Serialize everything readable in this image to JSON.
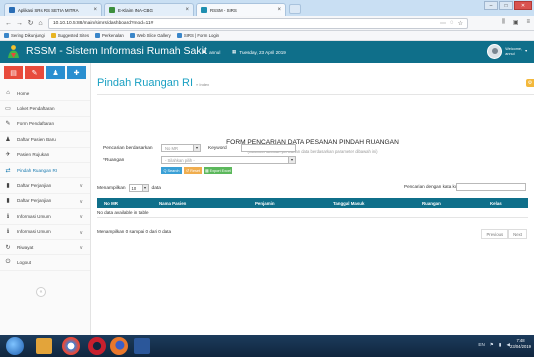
{
  "browser": {
    "tabs": [
      {
        "label": "Aplikasi SRs RS SETIA MITRA",
        "color": "#2a6db5",
        "active": false
      },
      {
        "label": "E-Klaim INA-CBG",
        "color": "#3d8f3d",
        "active": false
      },
      {
        "label": "RSSM - SIRS",
        "color": "#1f8fb0",
        "active": true
      }
    ],
    "window_controls": {
      "minimize": "–",
      "maximize": "□",
      "close": "✕"
    },
    "url": "10.10.10.5:88/main/simrs/dashboard?mod=11#",
    "bookmarks": [
      {
        "label": "Sering Dikunjungi",
        "color": "#3a86c9"
      },
      {
        "label": "Suggested Sites",
        "color": "#e7b423"
      },
      {
        "label": "Perkenalan",
        "color": "#3a86c9"
      },
      {
        "label": "Web Slice Gallery",
        "color": "#3a86c9"
      },
      {
        "label": "SIRS | Form Login",
        "color": "#3a86c9"
      }
    ]
  },
  "app": {
    "title": "RSSM - Sistem Informasi Rumah Sakit",
    "user": "annul",
    "date": "Tuesday, 23 April 2019",
    "welcome": "Welcome,",
    "welcome_user": "annul"
  },
  "sidebar": {
    "quick_buttons": [
      {
        "icon": "chart-icon",
        "glyph": "▤",
        "color": "#e84b3c"
      },
      {
        "icon": "pencil-icon",
        "glyph": "✎",
        "color": "#e84b3c"
      },
      {
        "icon": "user-icon",
        "glyph": "♟",
        "color": "#2a8fd0"
      },
      {
        "icon": "settings-icon",
        "glyph": "✚",
        "color": "#2a8fd0"
      }
    ],
    "items": [
      {
        "label": "Home",
        "icon": "home-icon",
        "glyph": "⌂",
        "chev": ""
      },
      {
        "label": "Loket Pendaftaran",
        "icon": "desk-icon",
        "glyph": "▭",
        "chev": ""
      },
      {
        "label": "Form Pendaftaran",
        "icon": "form-icon",
        "glyph": "✎",
        "chev": ""
      },
      {
        "label": "Daftar Pasien Baru",
        "icon": "patient-icon",
        "glyph": "♟",
        "chev": ""
      },
      {
        "label": "Pasien Rujukan",
        "icon": "referral-icon",
        "glyph": "✈",
        "chev": ""
      },
      {
        "label": "Pindah Ruangan RI",
        "icon": "transfer-icon",
        "glyph": "⇄",
        "chev": "",
        "active": true
      },
      {
        "label": "Daftar Perjanjian",
        "icon": "lock-icon",
        "glyph": "▮",
        "chev": "∨"
      },
      {
        "label": "Daftar Perjanjian",
        "icon": "lock-icon",
        "glyph": "▮",
        "chev": "∨"
      },
      {
        "label": "Informasi Umum",
        "icon": "info-icon",
        "glyph": "ℹ",
        "chev": "∨"
      },
      {
        "label": "Informasi Umum",
        "icon": "info-icon",
        "glyph": "ℹ",
        "chev": "∨"
      },
      {
        "label": "Riwayat",
        "icon": "history-icon",
        "glyph": "↻",
        "chev": "∨"
      },
      {
        "label": "Logout",
        "icon": "power-icon",
        "glyph": "⏻",
        "chev": ""
      }
    ],
    "collapse_glyph": "«"
  },
  "main": {
    "page_title": "Pindah Ruangan RI",
    "breadcrumb": "» Index",
    "form_title": "FORM PENCARIAN DATA PESANAN PINDAH RUANGAN",
    "form_subtitle": "(Silahkan lakukan pencarian data berdasarkan parameter dibawah ini)",
    "search_by_label": "Pencarian berdasarkan",
    "search_by_value": "No MR",
    "keyword_label": "Keyword",
    "ruangan_label": "*Ruangan",
    "ruangan_value": "- Silahkan pilih -",
    "buttons": {
      "search": "Q Search",
      "reset": "↺ Reset",
      "export": "▦ Export Excel"
    },
    "show_label": "Menampilkan",
    "show_value": "10",
    "show_suffix": "data",
    "search_label": "Pencarian dengan kata kunci :",
    "columns": [
      "No MR",
      "Nama Pasien",
      "Penjamin",
      "Tanggal Masuk",
      "Ruangan",
      "Kelas"
    ],
    "empty_text": "No data available in table",
    "info_text": "Menampilkan 0 sampai 0 dari 0 data",
    "pager": {
      "prev": "Previous",
      "next": "Next"
    }
  },
  "taskbar": {
    "apps": [
      {
        "icon": "start-icon",
        "color": "#3b8ee0"
      },
      {
        "icon": "explorer-icon",
        "color": "#e3a43a"
      },
      {
        "icon": "chrome-icon",
        "color": "#e64a3b"
      },
      {
        "icon": "opera-icon",
        "color": "#c8202e"
      },
      {
        "icon": "firefox-icon",
        "color": "#e9772c"
      },
      {
        "icon": "word-icon",
        "color": "#2b579a"
      }
    ],
    "tray_text": "EN",
    "time": "7:48",
    "date": "23/04/2019"
  },
  "colors": {
    "header": "#0f6f8a",
    "accent": "#1aa0c2",
    "btn_search": "#3aa0d6",
    "btn_reset": "#f0ad4e",
    "btn_export": "#5cb85c"
  }
}
